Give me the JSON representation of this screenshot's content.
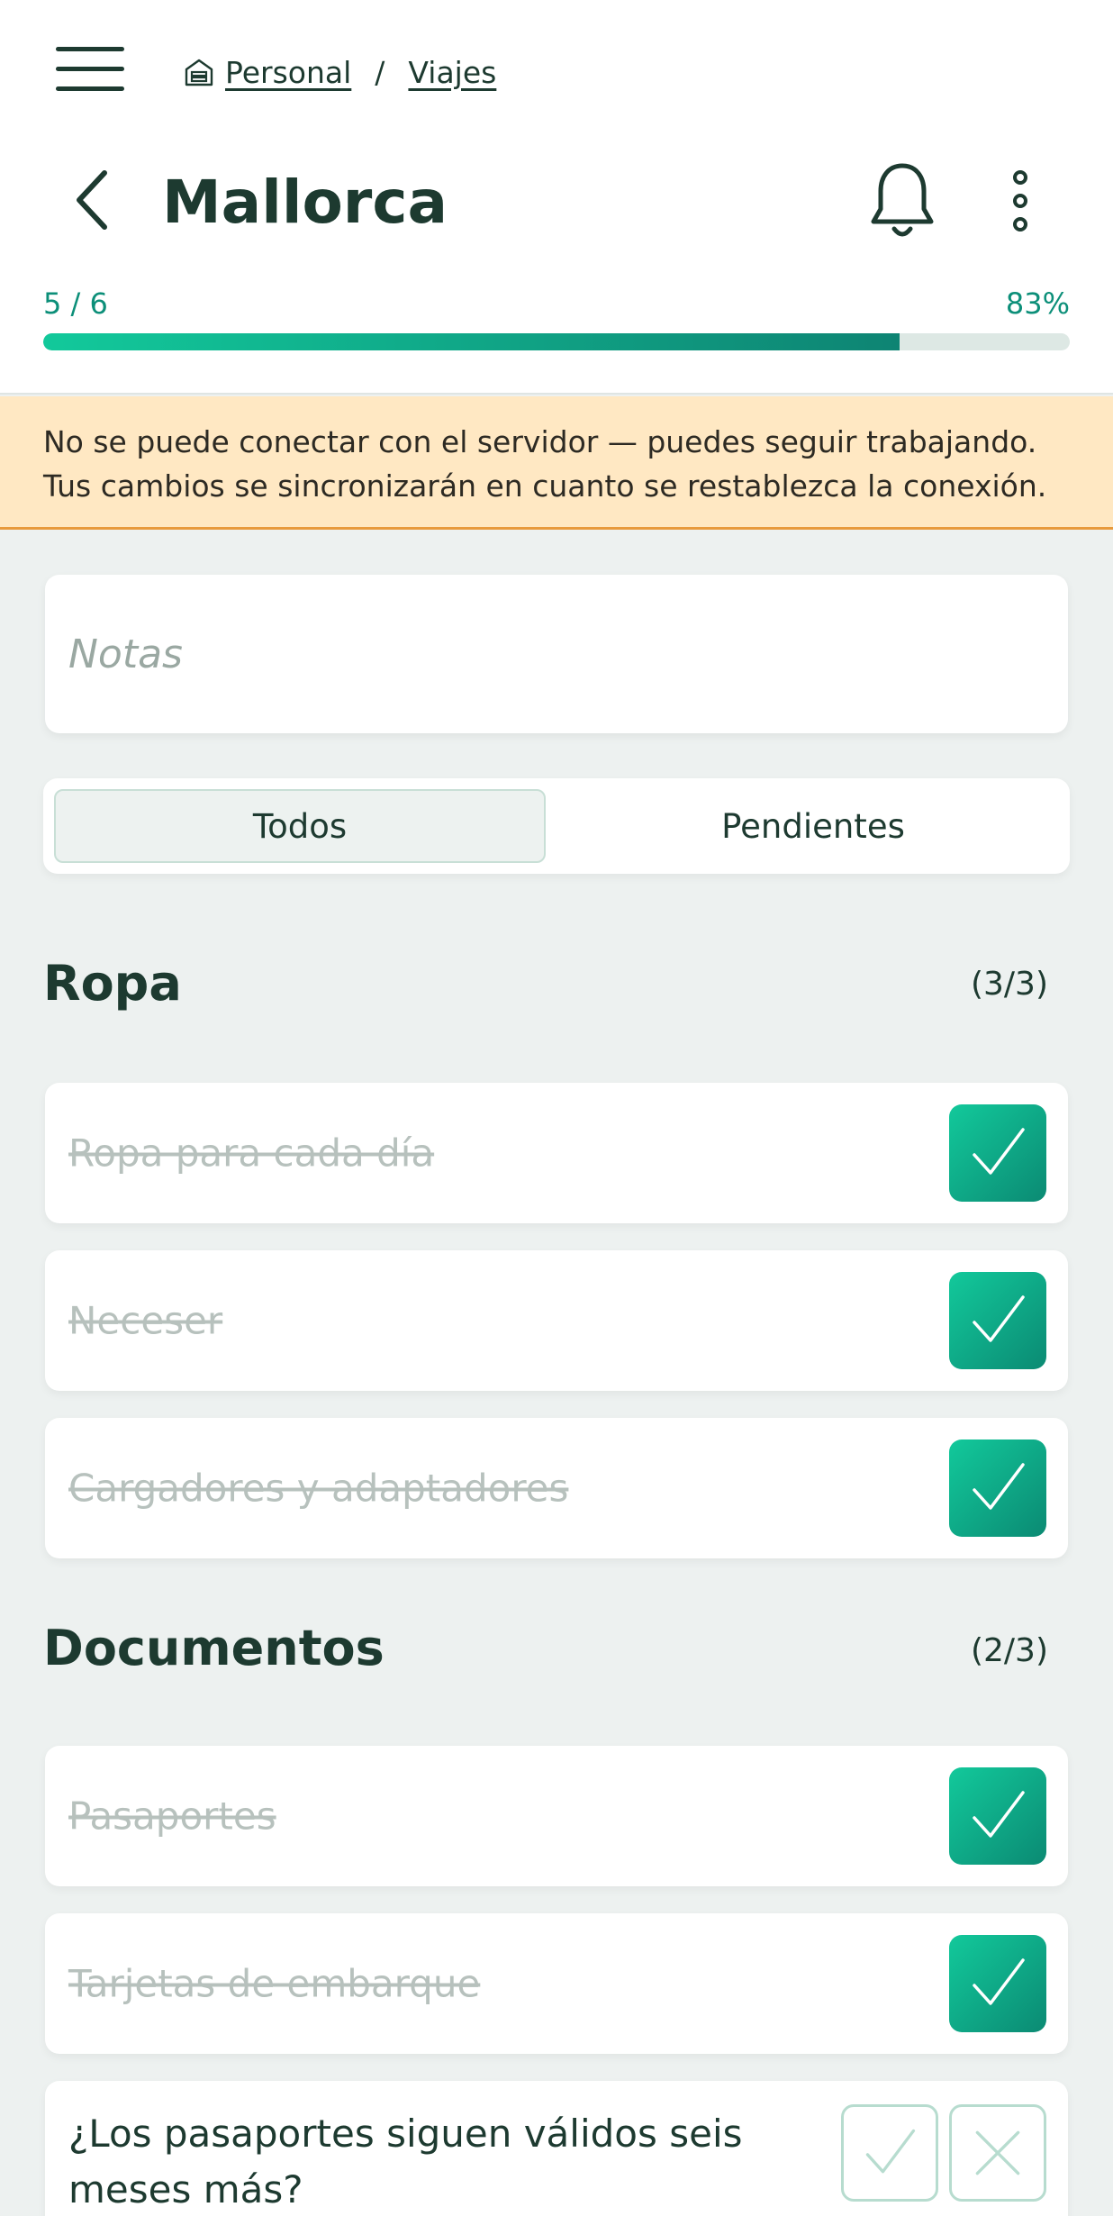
{
  "breadcrumb": {
    "parent": "Personal",
    "separator": "/",
    "current": "Viajes"
  },
  "header": {
    "title": "Mallorca"
  },
  "progress": {
    "count_label": "5 / 6",
    "percent_label": "83%",
    "fraction": 0.834
  },
  "banner": {
    "text": "No se puede conectar con el servidor — puedes seguir trabajando. Tus cambios se sincronizarán en cuanto se restablezca la conexión."
  },
  "notes": {
    "placeholder": "Notas",
    "value": ""
  },
  "filters": {
    "all": "Todos",
    "pending": "Pendientes",
    "selected": "all"
  },
  "sections": [
    {
      "title": "Ropa",
      "count": "(3/3)",
      "items": [
        {
          "label": "Ropa para cada día",
          "checked": true
        },
        {
          "label": "Neceser",
          "checked": true
        },
        {
          "label": "Cargadores y adaptadores",
          "checked": true
        }
      ]
    },
    {
      "title": "Documentos",
      "count": "(2/3)",
      "items": [
        {
          "label": "Pasaportes",
          "checked": true
        },
        {
          "label": "Tarjetas de embarque",
          "checked": true
        }
      ],
      "question": {
        "text": "¿Los pasaportes siguen válidos seis meses más?"
      }
    }
  ],
  "icons": {
    "menu": "hamburger-menu-icon",
    "home": "home-icon",
    "back": "chevron-left-icon",
    "notifications": "bell-icon",
    "more": "more-vertical-icon",
    "check": "check-icon",
    "close": "close-icon"
  },
  "colors": {
    "accent": "#0c8f79",
    "banner_bg": "#ffe8c3",
    "banner_border": "#e89a3c",
    "text": "#1d3a30"
  }
}
